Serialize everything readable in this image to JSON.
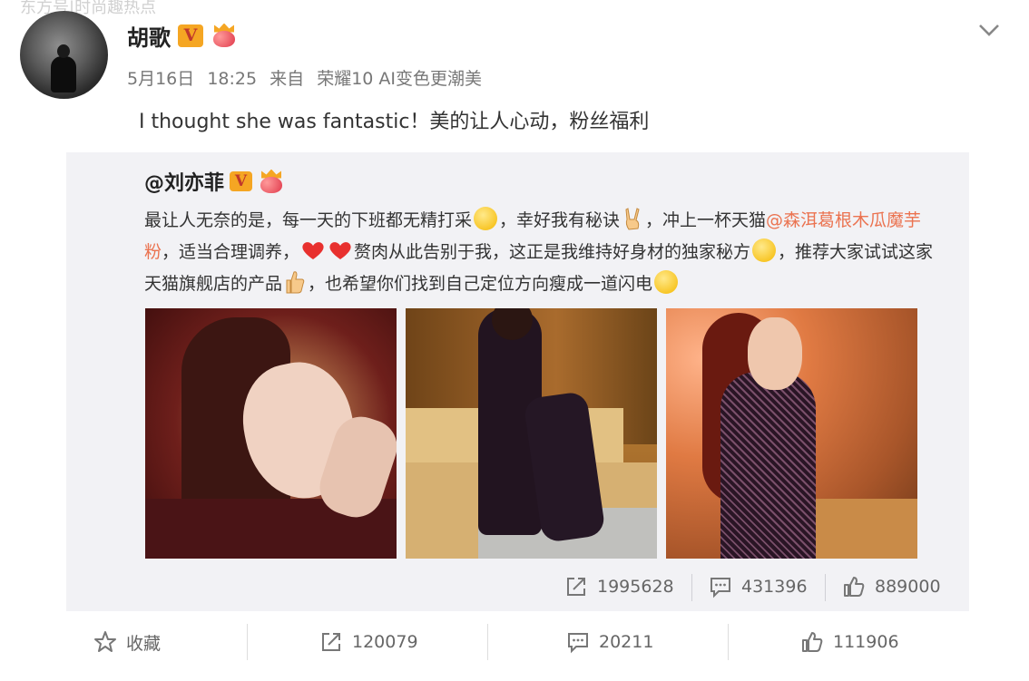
{
  "watermark": "东方号|时尚趣热点",
  "post": {
    "user_name": "胡歌",
    "v_label": "V",
    "date": "5月16日",
    "time": "18:25",
    "source_prefix": "来自",
    "source": "荣耀10 AI变色更潮美",
    "text": "I thought she was fantastic！美的让人心动，粉丝福利"
  },
  "repost": {
    "author": "@刘亦菲",
    "v_label": "V",
    "text_parts": {
      "p1": "最让人无奈的是，每一天的下班都无精打采",
      "p2": "，幸好我有秘诀",
      "p3": "，冲上一杯天猫",
      "link": "@森洱葛根木瓜魔芋粉",
      "p4": "，适当合理调养，",
      "p5": "赘肉从此告别于我，这正是我维持好身材的独家秘方",
      "p6": "，推荐大家试试这家天猫旗舰店的产品",
      "p7": "，也希望你们找到自己定位方向瘦成一道闪电"
    },
    "actions": {
      "repost_count": "1995628",
      "comment_count": "431396",
      "like_count": "889000"
    }
  },
  "actions": {
    "favorite_label": "收藏",
    "repost_count": "120079",
    "comment_count": "20211",
    "like_count": "111906"
  },
  "colors": {
    "link": "#eb7350",
    "badge": "#f5a623",
    "card_bg": "#f2f2f5"
  }
}
